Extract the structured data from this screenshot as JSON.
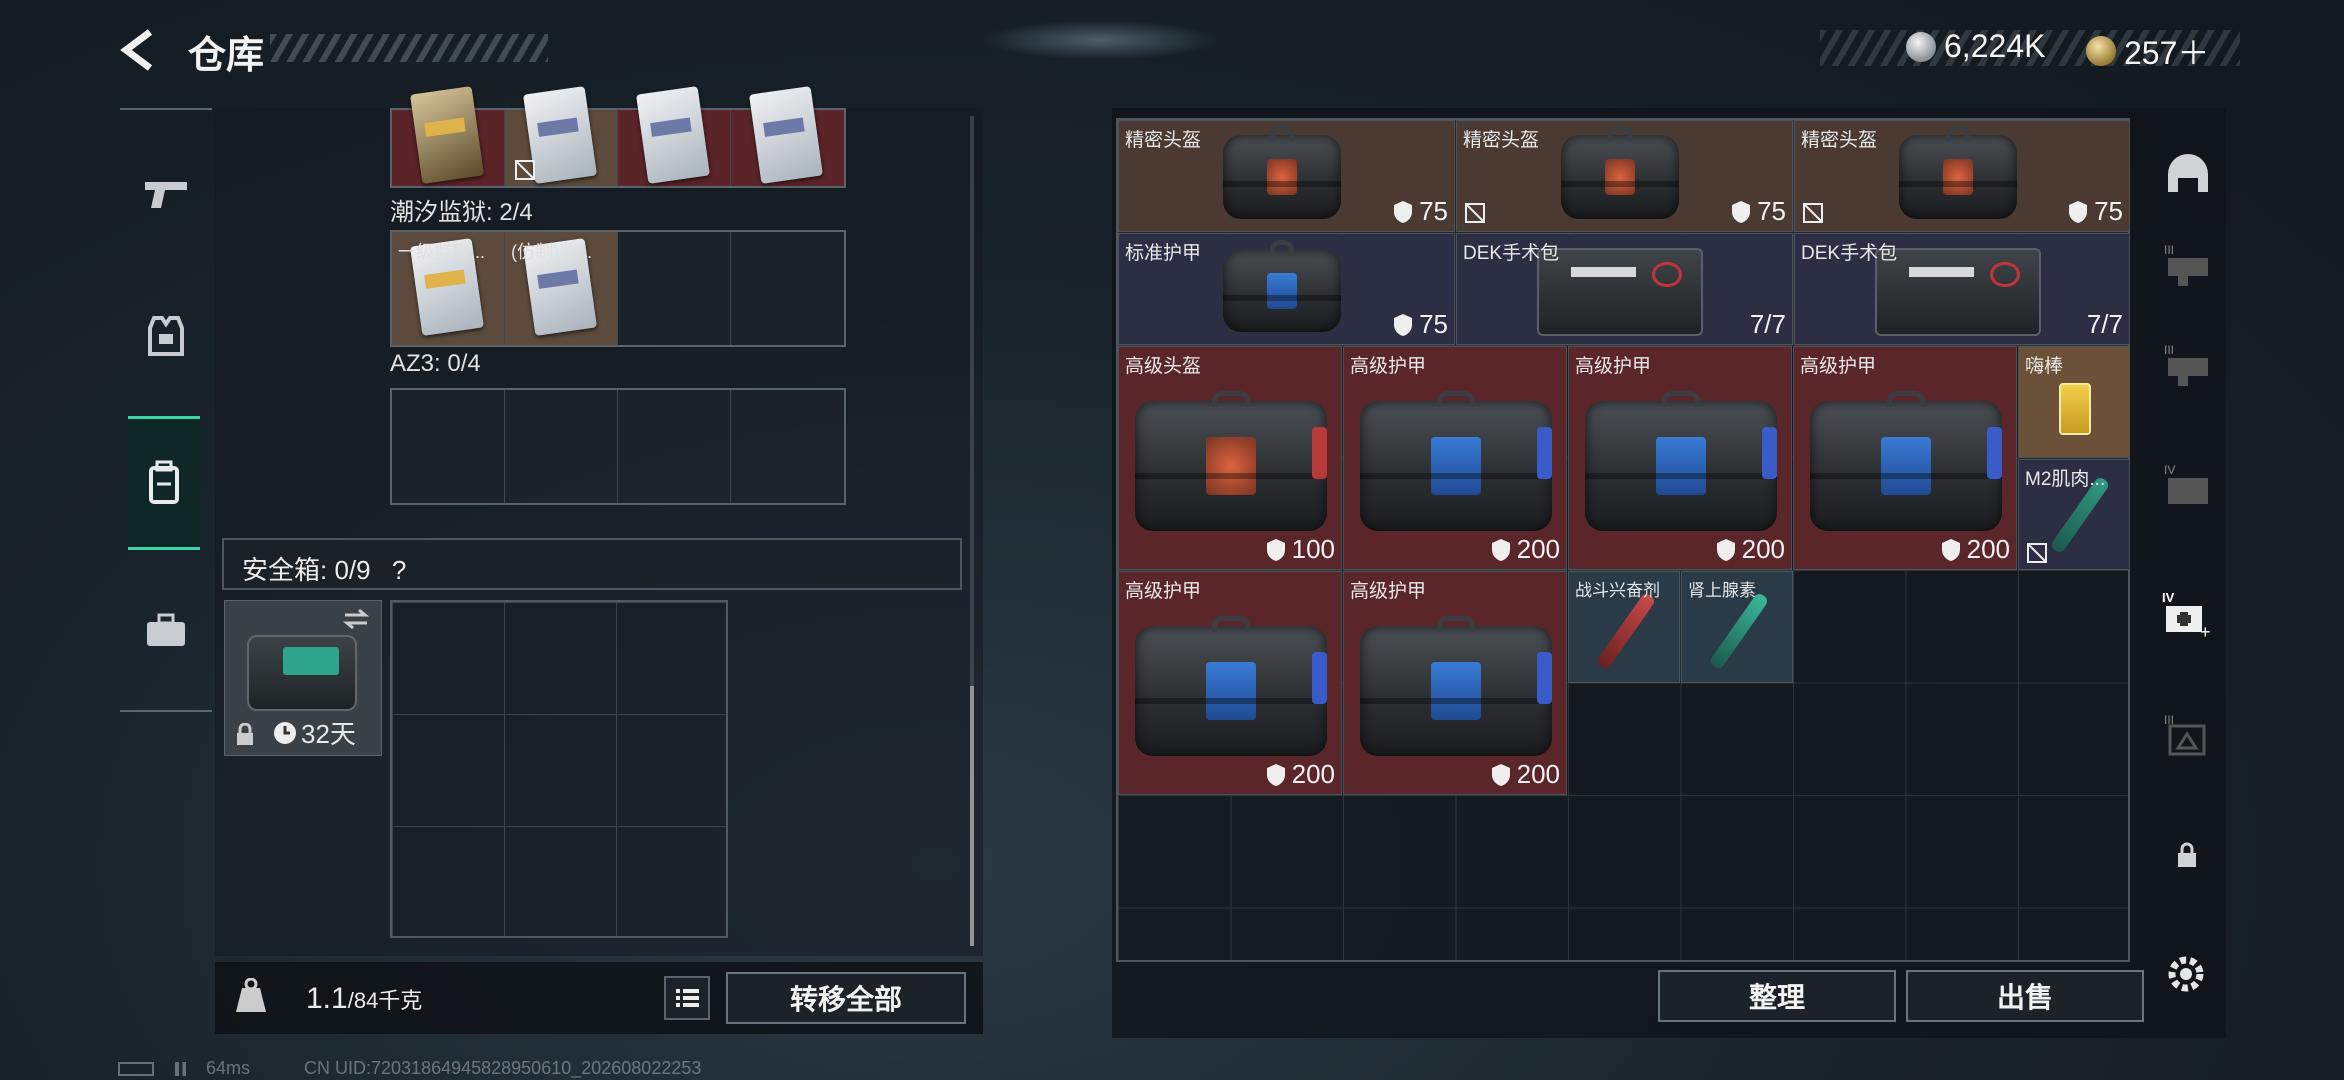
{
  "header": {
    "title": "仓库",
    "currency": [
      {
        "icon": "silver-coin-icon",
        "value": "6,224K"
      },
      {
        "icon": "gold-coin-icon",
        "value": "257＋"
      }
    ]
  },
  "left_nav": [
    {
      "icon": "gun-icon"
    },
    {
      "icon": "armor-vest-icon"
    },
    {
      "icon": "backpack-icon",
      "active": true
    },
    {
      "icon": "briefcase-icon"
    }
  ],
  "loadout": {
    "tide_prison_label": "潮汐监狱: 2/4",
    "tide_prison_cards": [
      "一级监狱...",
      "(仿制)监..."
    ],
    "az3_label": "AZ3: 0/4",
    "safe_label": "安全箱: 0/9",
    "safe_help": "?",
    "safe_duration": "32天"
  },
  "footer_left": {
    "weight_value": "1.1",
    "weight_unit": "/84千克",
    "transfer_all": "转移全部"
  },
  "stash_items": [
    {
      "name": "精密头盔",
      "value": "75",
      "type": "helmet"
    },
    {
      "name": "精密头盔",
      "value": "75",
      "type": "helmet"
    },
    {
      "name": "精密头盔",
      "value": "75",
      "type": "helmet"
    },
    {
      "name": "标准护甲",
      "value": "75",
      "type": "armor"
    },
    {
      "name": "DEK手术包",
      "value": "7/7",
      "type": "kit"
    },
    {
      "name": "DEK手术包",
      "value": "7/7",
      "type": "kit"
    },
    {
      "name": "高级头盔",
      "value": "100",
      "type": "helmet"
    },
    {
      "name": "高级护甲",
      "value": "200",
      "type": "armor"
    },
    {
      "name": "高级护甲",
      "value": "200",
      "type": "armor"
    },
    {
      "name": "高级护甲",
      "value": "200",
      "type": "armor"
    },
    {
      "name": "嗨棒",
      "value": "",
      "type": "drink"
    },
    {
      "name": "M2肌肉...",
      "value": "",
      "type": "syringe"
    },
    {
      "name": "高级护甲",
      "value": "200",
      "type": "armor"
    },
    {
      "name": "高级护甲",
      "value": "200",
      "type": "armor"
    },
    {
      "name": "战斗兴奋剂",
      "value": "",
      "type": "syringe"
    },
    {
      "name": "肾上腺素",
      "value": "",
      "type": "syringe"
    }
  ],
  "footer_right": {
    "sort": "整理",
    "sell": "出售"
  },
  "right_rail": [
    "helmet-slot-icon",
    "armor-tier3-icon",
    "armor-tier3-icon",
    "folder-tier4-icon",
    "medkit-tier4-icon",
    "tier3-box-icon",
    "lock-icon"
  ],
  "status_bar": {
    "ping": "64ms",
    "uid": "CN UID:72031864945828950610_202608022253"
  }
}
